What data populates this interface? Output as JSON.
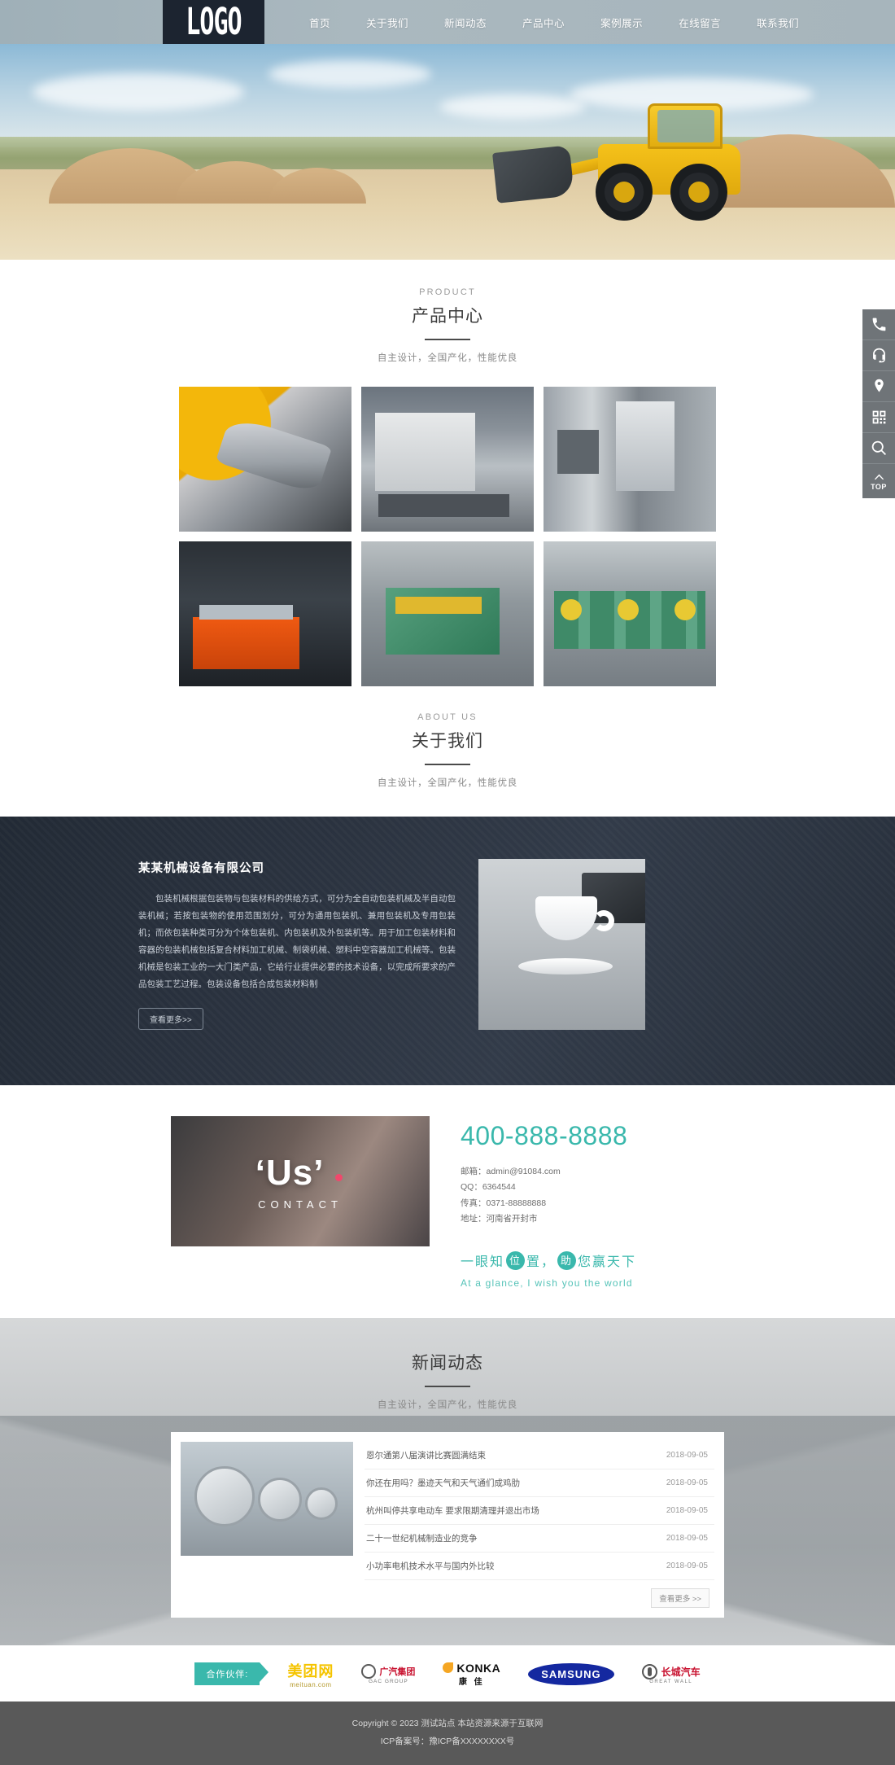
{
  "header": {
    "logo": "LOGO",
    "nav": [
      {
        "label": "首页"
      },
      {
        "label": "关于我们"
      },
      {
        "label": "新闻动态"
      },
      {
        "label": "产品中心"
      },
      {
        "label": "案例展示"
      },
      {
        "label": "在线留言"
      },
      {
        "label": "联系我们"
      }
    ]
  },
  "product": {
    "en": "PRODUCT",
    "cn": "产品中心",
    "sub": "自主设计，全国产化，性能优良",
    "items": [
      {
        "alt": "自动化焊接机械臂设备"
      },
      {
        "alt": "数控折弯机"
      },
      {
        "alt": "液压折弯机控制柜"
      },
      {
        "alt": "数控等离子切割机"
      },
      {
        "alt": "液压打包机"
      },
      {
        "alt": "冲床生产车间"
      }
    ]
  },
  "about": {
    "en": "ABOUT US",
    "cn": "关于我们",
    "sub": "自主设计，全国产化，性能优良",
    "company": "某某机械设备有限公司",
    "desc": "包装机械根据包装物与包装材料的供给方式，可分为全自动包装机械及半自动包装机械；若按包装物的使用范围划分，可分为通用包装机、兼用包装机及专用包装机；而依包装种类可分为个体包装机、内包装机及外包装机等。用于加工包装材料和容器的包装机械包括复合材料加工机械、制袋机械、塑料中空容器加工机械等。包装机械是包装工业的一大门类产品，它给行业提供必要的技术设备，以完成所要求的产品包装工艺过程。包装设备包括合成包装材料制",
    "more": "查看更多>>"
  },
  "contact": {
    "image_title": "Us",
    "image_sub": "CONTACT",
    "phone": "400-888-8888",
    "info": [
      "邮箱：admin@91084.com",
      "QQ：6364544",
      "传真：0371-88888888",
      "地址：河南省开封市"
    ],
    "slogan_parts": {
      "a": "一眼知",
      "b": "位",
      "c": "置",
      "d": "，",
      "e": "助",
      "f": "您赢天下"
    },
    "slogan_en": "At a glance, I wish you the world"
  },
  "news": {
    "cn": "新闻动态",
    "sub": "自主设计，全国产化，性能优良",
    "items": [
      {
        "title": "恩尔通第八届演讲比赛圆满结束",
        "date": "2018-09-05"
      },
      {
        "title": "你还在用吗？墨迹天气和天气通们成鸡肋",
        "date": "2018-09-05"
      },
      {
        "title": "杭州叫停共享电动车 要求限期清理并退出市场",
        "date": "2018-09-05"
      },
      {
        "title": "二十一世纪机械制造业的竞争",
        "date": "2018-09-05"
      },
      {
        "title": "小功率电机技术水平与国内外比较",
        "date": "2018-09-05"
      }
    ],
    "more": "查看更多 >>"
  },
  "partners": {
    "label": "合作伙伴:",
    "logos": [
      {
        "name": "meituan",
        "main": "美团网",
        "sub": "meituan.com"
      },
      {
        "name": "gac",
        "main": "广汽集团",
        "sub": "GAC GROUP"
      },
      {
        "name": "konka",
        "main": "KONKA",
        "sub": "康 佳"
      },
      {
        "name": "samsung",
        "main": "SAMSUNG",
        "sub": ""
      },
      {
        "name": "greatwall",
        "main": "长城汽车",
        "sub": "GREAT WALL"
      }
    ]
  },
  "footer": {
    "copyright": "Copyright © 2023 测试站点 本站资源来源于互联网",
    "icp": "ICP备案号：豫ICP备XXXXXXXX号"
  },
  "sidebar": {
    "items": [
      {
        "name": "phone-icon",
        "label": "电话"
      },
      {
        "name": "headset-icon",
        "label": "客服"
      },
      {
        "name": "location-icon",
        "label": "地址"
      },
      {
        "name": "qrcode-icon",
        "label": "二维码"
      },
      {
        "name": "search-icon",
        "label": "搜索"
      },
      {
        "name": "top-icon",
        "label": "TOP"
      }
    ],
    "top_label": "TOP"
  },
  "colors": {
    "accent": "#3ab8ac",
    "dark": "#222a35",
    "footer": "#595959"
  }
}
